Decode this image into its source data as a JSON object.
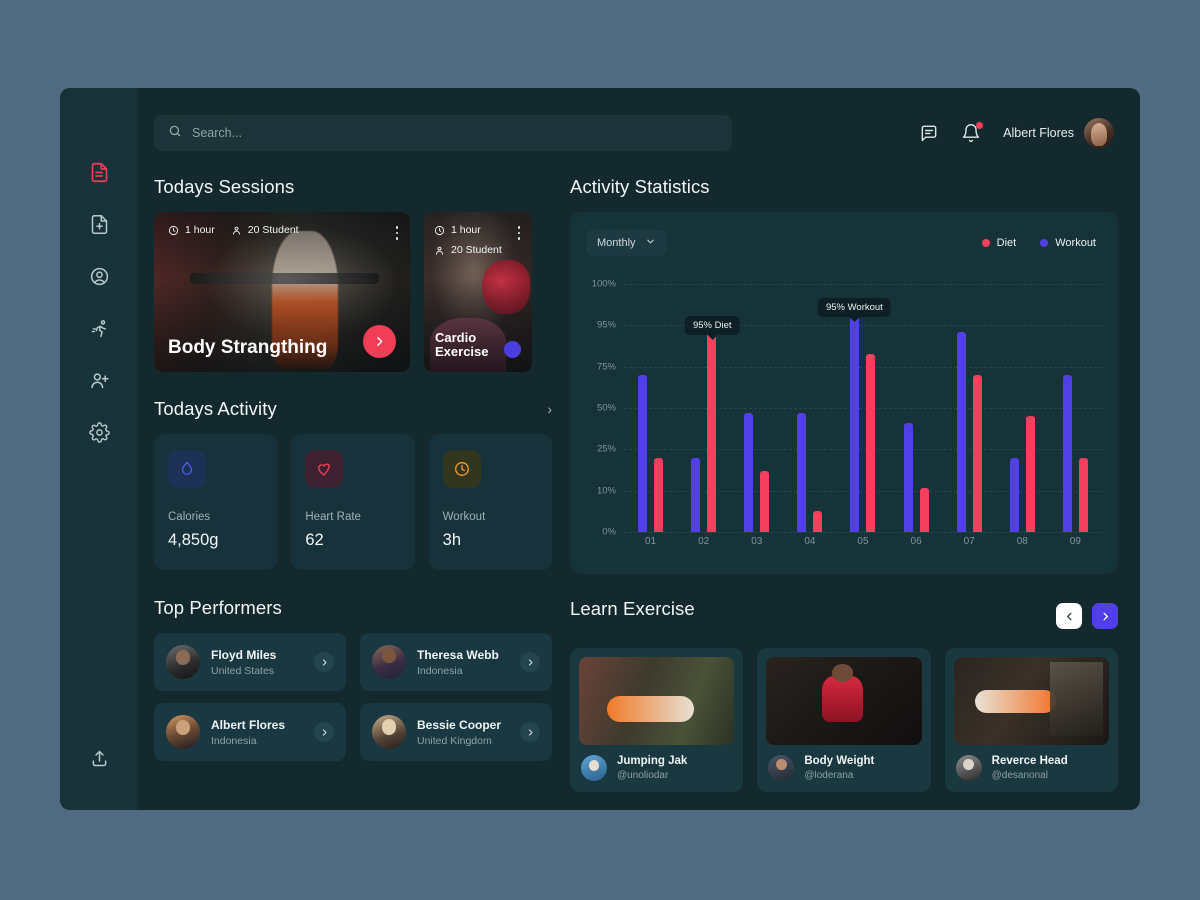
{
  "colors": {
    "page_background": "#506b81",
    "app_background": "#14292e",
    "sidebar": "#173238",
    "card": "#17323a",
    "accent_red": "#ef3e56",
    "accent_blue": "#5140e8",
    "diet": "#f43f5e",
    "workout": "#5140e8",
    "calories_icon": "#4b5ee8",
    "heart_icon": "#ef3e56",
    "workout_icon": "#f29b28"
  },
  "sidebar": {
    "items": [
      {
        "name": "document",
        "icon": "document-icon",
        "active": true
      },
      {
        "name": "add-document",
        "icon": "document-add-icon",
        "active": false
      },
      {
        "name": "profile",
        "icon": "user-circle-icon",
        "active": false
      },
      {
        "name": "training",
        "icon": "running-person-icon",
        "active": false
      },
      {
        "name": "add-member",
        "icon": "user-add-icon",
        "active": false
      },
      {
        "name": "settings",
        "icon": "gear-icon",
        "active": false
      }
    ],
    "bottom": {
      "name": "logout",
      "icon": "upload-icon"
    }
  },
  "header": {
    "search": {
      "value": "",
      "placeholder": "Search..."
    },
    "messages_icon": "chat-icon",
    "notifications_icon": "bell-icon",
    "has_notification": true,
    "user": {
      "name": "Albert Flores",
      "avatar": "user-avatar"
    }
  },
  "todays_sessions": {
    "title": "Todays Sessions",
    "cards": [
      {
        "title": "Body Strangthing",
        "duration": "1 hour",
        "students": "20 Student",
        "cta": "play-button"
      },
      {
        "title": "Cardio Exercise",
        "duration": "1 hour",
        "students": "20 Student",
        "cta": "blue-dot-button"
      }
    ]
  },
  "todays_activity": {
    "title": "Todays Activity",
    "more": "›",
    "cards": [
      {
        "icon": "water-drop-icon",
        "label": "Calories",
        "value": "4,850g"
      },
      {
        "icon": "heart-icon",
        "label": "Heart Rate",
        "value": "62"
      },
      {
        "icon": "clock-icon",
        "label": "Workout",
        "value": "3h"
      }
    ]
  },
  "top_performers": {
    "title": "Top Performers",
    "items": [
      {
        "name": "Floyd Miles",
        "location": "United States",
        "avatar": "av-floyd"
      },
      {
        "name": "Theresa Webb",
        "location": "Indonesia",
        "avatar": "av-theresa"
      },
      {
        "name": "Albert Flores",
        "location": "Indonesia",
        "avatar": "av-albert"
      },
      {
        "name": "Bessie Cooper",
        "location": "United Kingdom",
        "avatar": "av-bessie"
      }
    ]
  },
  "activity_statistics": {
    "title": "Activity Statistics",
    "period_selector": {
      "label": "Monthly",
      "icon": "chevron-down-icon"
    },
    "legend": [
      {
        "label": "Diet",
        "color": "#f43f5e"
      },
      {
        "label": "Workout",
        "color": "#5140e8"
      }
    ]
  },
  "chart_data": {
    "type": "bar",
    "title": "Activity Statistics",
    "xlabel": "",
    "ylabel": "",
    "categories": [
      "01",
      "02",
      "03",
      "04",
      "05",
      "06",
      "07",
      "08",
      "09"
    ],
    "ytick_labels": [
      "100%",
      "95%",
      "75%",
      "50%",
      "25%",
      "10%",
      "0%"
    ],
    "ytick_values": [
      100,
      95,
      75,
      50,
      25,
      10,
      0
    ],
    "ylim": [
      0,
      100
    ],
    "grid": true,
    "legend_position": "top-right",
    "series": [
      {
        "name": "Workout",
        "color": "#5140e8",
        "values": [
          70,
          22,
          47,
          47,
          96,
          41,
          92,
          22,
          70
        ]
      },
      {
        "name": "Diet",
        "color": "#f43f5e",
        "values": [
          22,
          92,
          17,
          5,
          81,
          11,
          70,
          45,
          22
        ]
      }
    ],
    "annotations": [
      {
        "text": "95% Diet",
        "category": "02",
        "series": "Diet",
        "value": 92
      },
      {
        "text": "95% Workout",
        "category": "05",
        "series": "Workout",
        "value": 96
      }
    ]
  },
  "learn_exercise": {
    "title": "Learn Exercise",
    "prev_icon": "chevron-left-icon",
    "next_icon": "chevron-right-icon",
    "cards": [
      {
        "name": "Jumping Jak",
        "handle": "@unoliodar",
        "image": "li-1",
        "avatar": "lav-1"
      },
      {
        "name": "Body Weight",
        "handle": "@loderana",
        "image": "li-2",
        "avatar": "lav-2"
      },
      {
        "name": "Reverce Head",
        "handle": "@desanonal",
        "image": "li-3",
        "avatar": "lav-3"
      }
    ]
  }
}
